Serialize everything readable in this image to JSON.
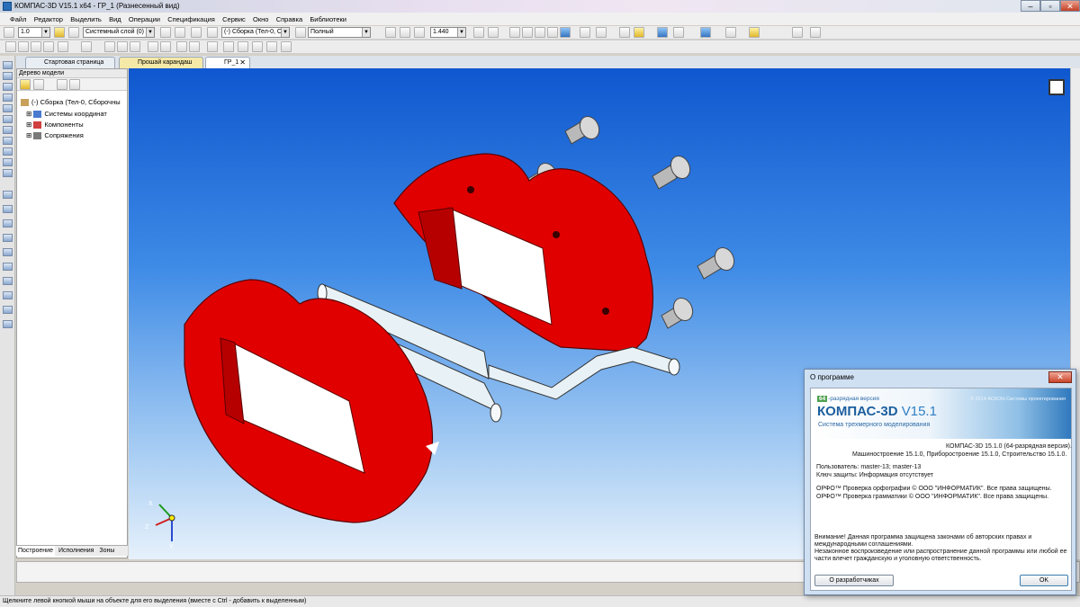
{
  "window": {
    "title": "КОМПАС-3D V15.1 x64 - ГР_1 (Разнесенный вид)",
    "min": "–",
    "max": "▫",
    "close": "✕"
  },
  "menu": [
    "Файл",
    "Редактор",
    "Выделить",
    "Вид",
    "Операции",
    "Спецификация",
    "Сервис",
    "Окно",
    "Справка",
    "Библиотеки"
  ],
  "toolbar": {
    "step_value": "1.0",
    "layer_value": "Системный слой (0)",
    "assembly_value": "(-) Сборка (Тел-0, С",
    "mode_value": "Полный",
    "zoom_value": "1.440"
  },
  "doc_tabs": [
    {
      "label": "Стартовая страница"
    },
    {
      "label": "Прошай карандаш"
    },
    {
      "label": "ГР_1",
      "close": "✕"
    }
  ],
  "tree": {
    "header": "Дерево модели",
    "nodes": [
      {
        "label": "(-) Сборка (Тел-0, Сборочны"
      },
      {
        "label": "Системы координат"
      },
      {
        "label": "Компоненты"
      },
      {
        "label": "Сопряжения"
      }
    ],
    "tabs": [
      "Построение",
      "Исполнения",
      "Зоны"
    ]
  },
  "axes": {
    "x": "X",
    "y": "Y",
    "z": "Z"
  },
  "status": "Щелкните левой кнопкой мыши на объекте для его выделения (вместе с Ctrl - добавить к выделенным)",
  "about": {
    "title": "О программе",
    "close": "✕",
    "bits_badge": "64",
    "bits_text": "-разрядная версия",
    "copyright": "© 2014 АСКОН-Системы проектирования",
    "product": "КОМПАС-3D",
    "version": "V15.1",
    "subtitle": "Система трехмерного моделирования",
    "line1": "КОМПАС-3D 15.1.0 (64-разрядная версия).",
    "line2": "Машиностроение 15.1.0, Приборостроение 15.1.0, Строительство 15.1.0.",
    "user": "Пользователь: master-13; master-13",
    "key": "Ключ защиты: Информация отсутствует",
    "orfo1": "ОРФО™ Проверка орфографии © ООО \"ИНФОРМАТИК\". Все права защищены.",
    "orfo2": "ОРФО™ Проверка грамматики © ООО \"ИНФОРМАТИК\". Все права защищены.",
    "warn1": "Внимание! Данная программа защищена законами об авторских правах и",
    "warn2": "международными соглашениями.",
    "warn3": "Незаконное воспроизведение или распространение данной программы или любой ее",
    "warn4": "части влечет гражданскую и уголовную ответственность.",
    "dev_button": "О разработчиках",
    "ok_button": "OK"
  }
}
